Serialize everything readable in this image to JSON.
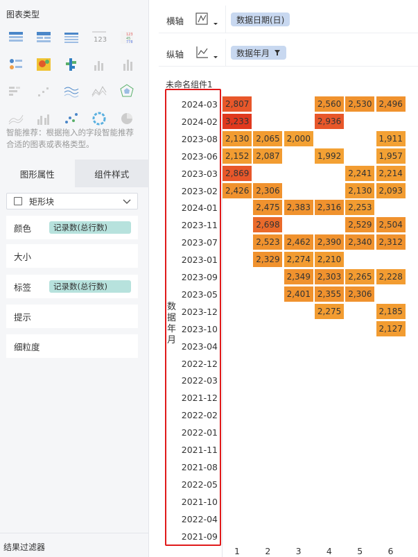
{
  "left_panel": {
    "chart_type_title": "图表类型",
    "chart_icons": [
      "table-icon",
      "cross-table-icon",
      "detail-table-icon",
      "kpi-number-icon",
      "color-table-icon",
      "point-map-icon",
      "heatmap-icon",
      "multi-series-bar-icon",
      "bar-chart-icon",
      "column-chart-icon",
      "stacked-bar-icon",
      "scatter-step-icon",
      "wave-line-icon",
      "area-line-icon",
      "radar-icon",
      "line-area-icon",
      "grouped-column-icon",
      "bubble-icon",
      "ring-icon",
      "pie-icon"
    ],
    "hint": "智能推荐：根据拖入的字段智能推荐合适的图表或表格类型。",
    "tabs": {
      "graph_props": "图形属性",
      "widget_style": "组件样式"
    },
    "shape_select": "矩形块",
    "props": {
      "color": "颜色",
      "color_field": "记录数(总行数)",
      "size": "大小",
      "label": "标签",
      "label_field": "记录数(总行数)",
      "tooltip": "提示",
      "granularity": "细粒度"
    },
    "filter_title": "结果过滤器"
  },
  "axes": {
    "x_label": "横轴",
    "x_field": "数据日期(日)",
    "y_label": "纵轴",
    "y_field": "数据年月"
  },
  "widget_title": "未命名组件1",
  "matrix": {
    "y_axis_title": "数据年月",
    "rows": [
      "2024-03",
      "2024-02",
      "2023-08",
      "2023-06",
      "2023-03",
      "2023-02",
      "2024-01",
      "2023-11",
      "2023-07",
      "2023-01",
      "2023-09",
      "2023-05",
      "2023-12",
      "2023-10",
      "2023-04",
      "2022-12",
      "2022-03",
      "2021-12",
      "2022-02",
      "2022-01",
      "2021-11",
      "2021-08",
      "2022-05",
      "2021-10",
      "2022-04",
      "2021-09"
    ],
    "columns": [
      "1",
      "2",
      "3",
      "4",
      "5",
      "6"
    ],
    "cells": [
      {
        "r": 0,
        "c": 0,
        "v": "2,807",
        "color": "#e8572a"
      },
      {
        "r": 0,
        "c": 3,
        "v": "2,560",
        "color": "#f0922e"
      },
      {
        "r": 0,
        "c": 4,
        "v": "2,530",
        "color": "#f0922e"
      },
      {
        "r": 0,
        "c": 5,
        "v": "2,496",
        "color": "#f0922e"
      },
      {
        "r": 1,
        "c": 0,
        "v": "3,233",
        "color": "#e0391e"
      },
      {
        "r": 1,
        "c": 3,
        "v": "2,936",
        "color": "#e8572a"
      },
      {
        "r": 2,
        "c": 0,
        "v": "2,130",
        "color": "#f29c31"
      },
      {
        "r": 2,
        "c": 1,
        "v": "2,065",
        "color": "#f29c31"
      },
      {
        "r": 2,
        "c": 2,
        "v": "2,000",
        "color": "#f3a134"
      },
      {
        "r": 2,
        "c": 5,
        "v": "1,911",
        "color": "#f3a134"
      },
      {
        "r": 3,
        "c": 0,
        "v": "2,152",
        "color": "#f29c31"
      },
      {
        "r": 3,
        "c": 1,
        "v": "2,087",
        "color": "#f29c31"
      },
      {
        "r": 3,
        "c": 3,
        "v": "1,992",
        "color": "#f3a134"
      },
      {
        "r": 3,
        "c": 5,
        "v": "1,957",
        "color": "#f3a134"
      },
      {
        "r": 4,
        "c": 0,
        "v": "2,869",
        "color": "#e8572a"
      },
      {
        "r": 4,
        "c": 4,
        "v": "2,241",
        "color": "#f29c31"
      },
      {
        "r": 4,
        "c": 5,
        "v": "2,214",
        "color": "#f29c31"
      },
      {
        "r": 5,
        "c": 0,
        "v": "2,426",
        "color": "#f0922e"
      },
      {
        "r": 5,
        "c": 1,
        "v": "2,306",
        "color": "#f0922e"
      },
      {
        "r": 5,
        "c": 4,
        "v": "2,130",
        "color": "#f29c31"
      },
      {
        "r": 5,
        "c": 5,
        "v": "2,093",
        "color": "#f29c31"
      },
      {
        "r": 6,
        "c": 1,
        "v": "2,475",
        "color": "#f0922e"
      },
      {
        "r": 6,
        "c": 2,
        "v": "2,383",
        "color": "#f0922e"
      },
      {
        "r": 6,
        "c": 3,
        "v": "2,316",
        "color": "#f0922e"
      },
      {
        "r": 6,
        "c": 4,
        "v": "2,253",
        "color": "#f29c31"
      },
      {
        "r": 7,
        "c": 1,
        "v": "2,698",
        "color": "#ea6a2a"
      },
      {
        "r": 7,
        "c": 4,
        "v": "2,529",
        "color": "#f0922e"
      },
      {
        "r": 7,
        "c": 5,
        "v": "2,504",
        "color": "#f0922e"
      },
      {
        "r": 8,
        "c": 1,
        "v": "2,523",
        "color": "#f0922e"
      },
      {
        "r": 8,
        "c": 2,
        "v": "2,462",
        "color": "#f0922e"
      },
      {
        "r": 8,
        "c": 3,
        "v": "2,390",
        "color": "#f0922e"
      },
      {
        "r": 8,
        "c": 4,
        "v": "2,340",
        "color": "#f0922e"
      },
      {
        "r": 8,
        "c": 5,
        "v": "2,312",
        "color": "#f0922e"
      },
      {
        "r": 9,
        "c": 1,
        "v": "2,329",
        "color": "#f0922e"
      },
      {
        "r": 9,
        "c": 2,
        "v": "2,274",
        "color": "#f29c31"
      },
      {
        "r": 9,
        "c": 3,
        "v": "2,210",
        "color": "#f29c31"
      },
      {
        "r": 10,
        "c": 2,
        "v": "2,349",
        "color": "#f0922e"
      },
      {
        "r": 10,
        "c": 3,
        "v": "2,303",
        "color": "#f0922e"
      },
      {
        "r": 10,
        "c": 4,
        "v": "2,265",
        "color": "#f29c31"
      },
      {
        "r": 10,
        "c": 5,
        "v": "2,228",
        "color": "#f29c31"
      },
      {
        "r": 11,
        "c": 2,
        "v": "2,401",
        "color": "#f0922e"
      },
      {
        "r": 11,
        "c": 3,
        "v": "2,355",
        "color": "#f0922e"
      },
      {
        "r": 11,
        "c": 4,
        "v": "2,306",
        "color": "#f0922e"
      },
      {
        "r": 12,
        "c": 3,
        "v": "2,275",
        "color": "#f29c31"
      },
      {
        "r": 12,
        "c": 5,
        "v": "2,185",
        "color": "#f29c31"
      },
      {
        "r": 13,
        "c": 5,
        "v": "2,127",
        "color": "#f29c31"
      }
    ]
  },
  "colors": {
    "highlight_frame": "#e0191a",
    "pill_teal": "#b7e2dd",
    "pill_blue": "#c8d8f0"
  }
}
